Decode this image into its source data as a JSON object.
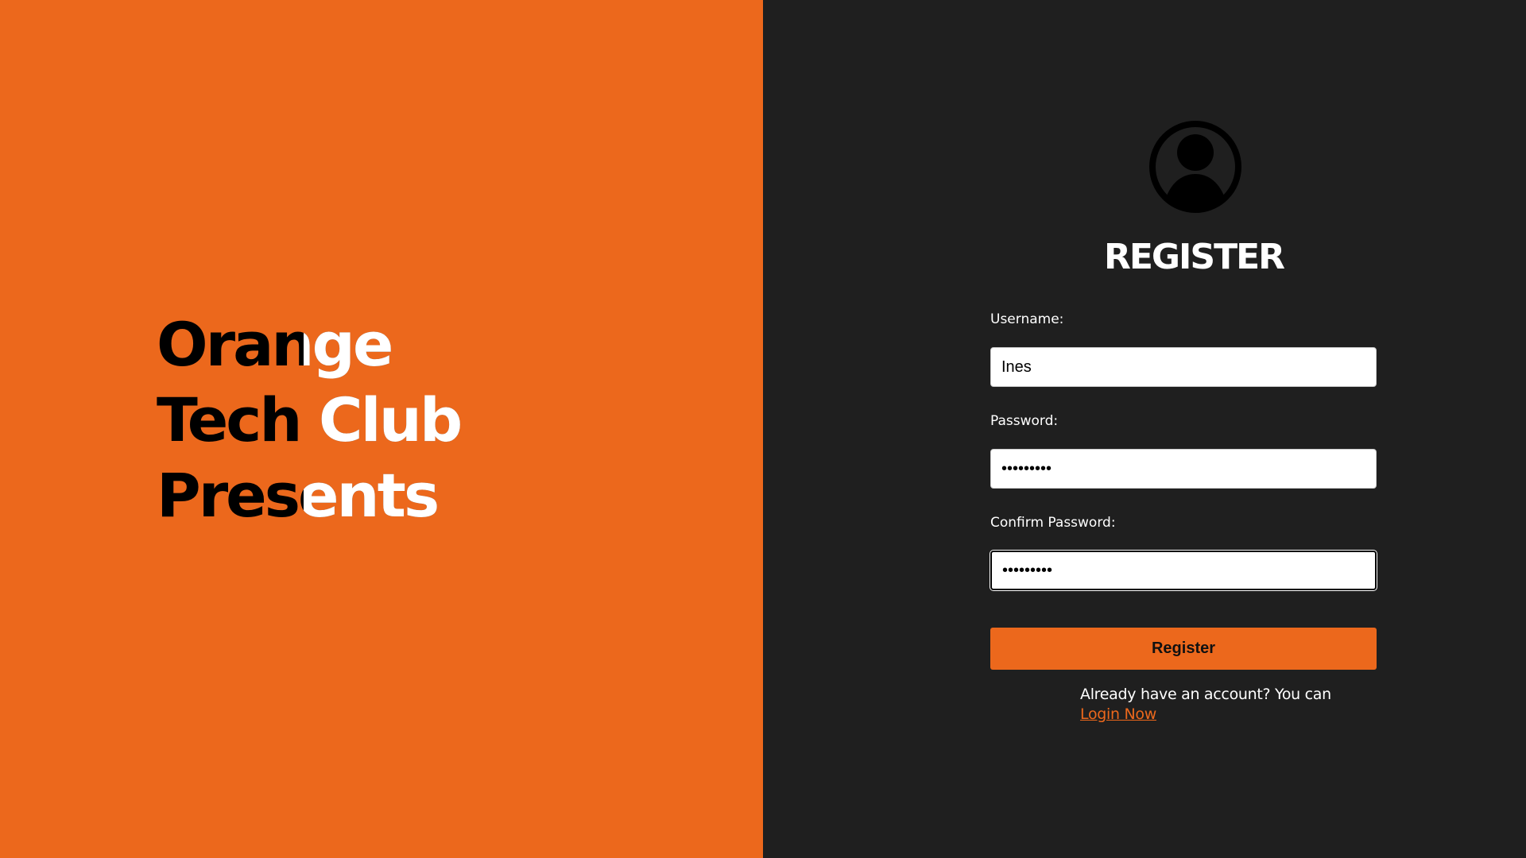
{
  "brand": {
    "headline_lines": [
      "Orange",
      "Tech Club",
      "Presents"
    ],
    "accent_color": "#ec681c",
    "dark_color": "#1f1f1f"
  },
  "form": {
    "avatar_icon": "user-circle-icon",
    "title": "REGISTER",
    "username_label": "Username:",
    "username_value": "Ines",
    "password_label": "Password:",
    "password_value": "123456789",
    "confirm_label": "Confirm Password:",
    "confirm_value": "123456789",
    "submit_label": "Register",
    "login_prompt": "Already have an account? You can",
    "login_link": "Login Now"
  }
}
